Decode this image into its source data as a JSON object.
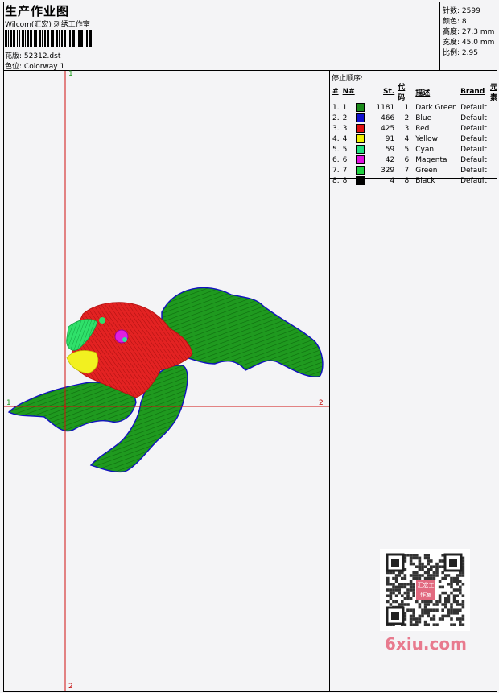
{
  "header": {
    "title": "生产作业图",
    "company": "Wilcom(汇宏) 刺绣工作室",
    "design_label": "花版:",
    "design_value": "52312.dst",
    "colorway_label": "色位:",
    "colorway_value": "Colorway 1"
  },
  "stats": [
    {
      "label": "针数:",
      "value": "2599"
    },
    {
      "label": "颜色:",
      "value": "8"
    },
    {
      "label": "高度:",
      "value": "27.3 mm"
    },
    {
      "label": "宽度:",
      "value": "45.0 mm"
    },
    {
      "label": "比例:",
      "value": "2.95"
    }
  ],
  "stop_sequence": {
    "title": "停止顺序:",
    "headers": [
      "#",
      "N#",
      "St.",
      "代码",
      "描述",
      "Brand",
      "元素"
    ],
    "rows": [
      {
        "num": "1.",
        "n": "1",
        "color": "#1a8a1a",
        "st": "1181",
        "code": "1",
        "desc": "Dark Green",
        "brand": "Default"
      },
      {
        "num": "2.",
        "n": "2",
        "color": "#1010d0",
        "st": "466",
        "code": "2",
        "desc": "Blue",
        "brand": "Default"
      },
      {
        "num": "3.",
        "n": "3",
        "color": "#e01010",
        "st": "425",
        "code": "3",
        "desc": "Red",
        "brand": "Default"
      },
      {
        "num": "4.",
        "n": "4",
        "color": "#f0f000",
        "st": "91",
        "code": "4",
        "desc": "Yellow",
        "brand": "Default"
      },
      {
        "num": "5.",
        "n": "5",
        "color": "#20e080",
        "st": "59",
        "code": "5",
        "desc": "Cyan",
        "brand": "Default"
      },
      {
        "num": "6.",
        "n": "6",
        "color": "#e010e0",
        "st": "42",
        "code": "6",
        "desc": "Magenta",
        "brand": "Default"
      },
      {
        "num": "7.",
        "n": "7",
        "color": "#20d040",
        "st": "329",
        "code": "7",
        "desc": "Green",
        "brand": "Default"
      },
      {
        "num": "8.",
        "n": "8",
        "color": "#000000",
        "st": "4",
        "code": "8",
        "desc": "Black",
        "brand": "Default"
      }
    ]
  },
  "axes": {
    "top": "1",
    "left": "1",
    "right": "2",
    "bottom": "2"
  },
  "watermark": "6xiu.com",
  "qr_badge": "汇宏工作室"
}
